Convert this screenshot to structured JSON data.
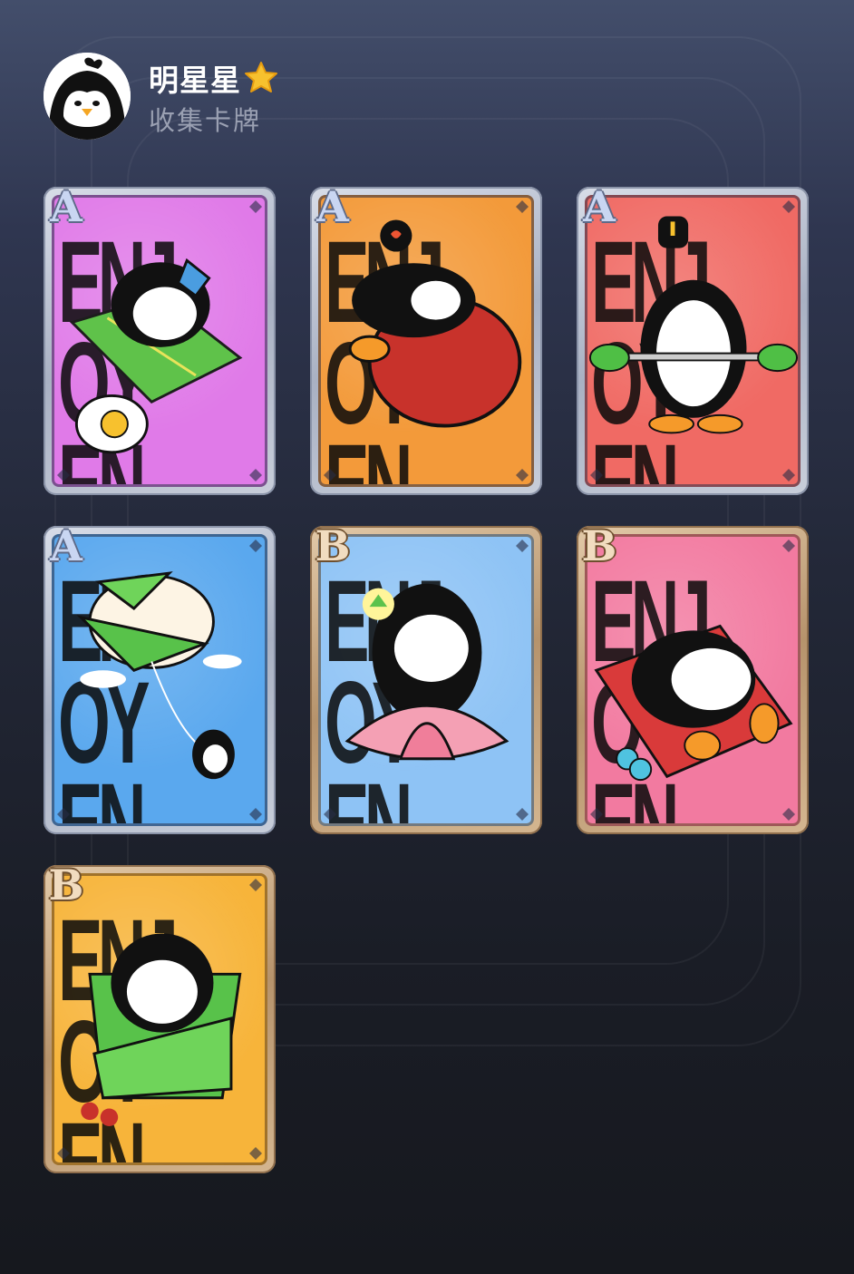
{
  "user": {
    "name": "明星星",
    "subtitle": "收集卡牌"
  },
  "cards": [
    {
      "tier": "A",
      "word": "ENJOY",
      "bg": "#e07ae8",
      "art": "penguin-zongzi-egg"
    },
    {
      "tier": "A",
      "word": "ENJOY",
      "bg": "#f39a3a",
      "art": "penguin-red-date"
    },
    {
      "tier": "A",
      "word": "ENJOY",
      "bg": "#f06a64",
      "art": "penguin-barbell"
    },
    {
      "tier": "A",
      "word": "ENJOY",
      "bg": "#5aa8ee",
      "art": "zongzi-kite"
    },
    {
      "tier": "B",
      "word": "ENJOY",
      "bg": "#8ec3f5",
      "art": "penguin-lotus"
    },
    {
      "tier": "B",
      "word": "ENJOY",
      "bg": "#f27aa0",
      "art": "penguin-yoga-mat"
    },
    {
      "tier": "B",
      "word": "ENJOY",
      "bg": "#f7b43a",
      "art": "penguin-zongzi-wrap"
    }
  ],
  "colors": {
    "tier_A_frame": "#a9b1c3",
    "tier_B_frame": "#b6936c",
    "name_text": "#ffffff",
    "subtitle_text": "#9aa0b2"
  }
}
